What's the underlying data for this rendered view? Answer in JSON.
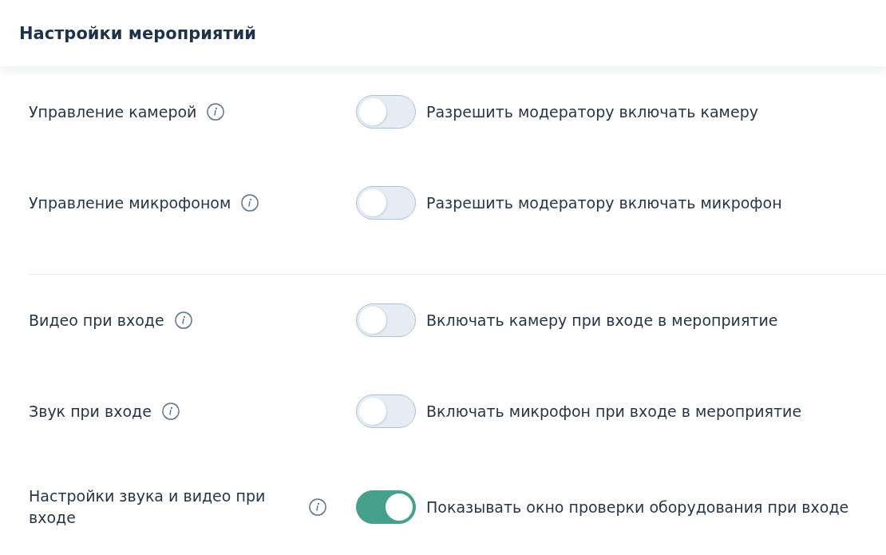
{
  "header": {
    "title": "Настройки мероприятий"
  },
  "groups": [
    {
      "rows": [
        {
          "label": "Управление камерой",
          "on": false,
          "description": "Разрешить модератору включать камеру"
        },
        {
          "label": "Управление микрофоном",
          "on": false,
          "description": "Разрешить модератору включать микрофон"
        }
      ]
    },
    {
      "rows": [
        {
          "label": "Видео при входе",
          "on": false,
          "description": "Включать камеру при входе в мероприятие"
        },
        {
          "label": "Звук при входе",
          "on": false,
          "description": "Включать микрофон при входе в мероприятие"
        },
        {
          "label": "Настройки звука и видео при входе",
          "on": true,
          "description": "Показывать окно проверки оборудования при входе"
        }
      ]
    }
  ]
}
